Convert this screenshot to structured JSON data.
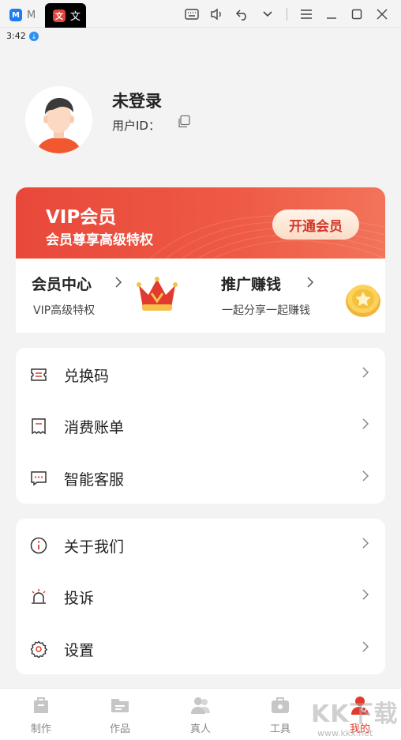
{
  "emulator": {
    "tab_inactive_label": "M",
    "tab_active_label": "文"
  },
  "status": {
    "time": "3:42"
  },
  "profile": {
    "name": "未登录",
    "user_id_label": "用户ID："
  },
  "vip": {
    "title": "VIP会员",
    "subtitle": "会员尊享高级特权",
    "button": "开通会员"
  },
  "member": {
    "left_title": "会员中心",
    "left_sub": "VIP高级特权",
    "right_title": "推广赚钱",
    "right_sub": "一起分享一起赚钱"
  },
  "menu_group_1": [
    {
      "label": "兑换码",
      "icon": "ticket-icon"
    },
    {
      "label": "消费账单",
      "icon": "receipt-icon"
    },
    {
      "label": "智能客服",
      "icon": "chat-icon"
    }
  ],
  "menu_group_2": [
    {
      "label": "关于我们",
      "icon": "info-icon"
    },
    {
      "label": "投诉",
      "icon": "alarm-icon"
    },
    {
      "label": "设置",
      "icon": "gear-icon"
    }
  ],
  "bottom_nav": [
    {
      "label": "制作",
      "icon": "bag-icon",
      "active": false
    },
    {
      "label": "作品",
      "icon": "folder-icon",
      "active": false
    },
    {
      "label": "真人",
      "icon": "people-icon",
      "active": false
    },
    {
      "label": "工具",
      "icon": "toolbox-icon",
      "active": false
    },
    {
      "label": "我的",
      "icon": "profile-icon",
      "active": true
    }
  ],
  "watermark": {
    "text": "KK下载",
    "url": "www.kkx.net"
  },
  "colors": {
    "accent": "#e23a2e",
    "vip_gradient_start": "#e8483a",
    "vip_gradient_end": "#f3735a"
  }
}
